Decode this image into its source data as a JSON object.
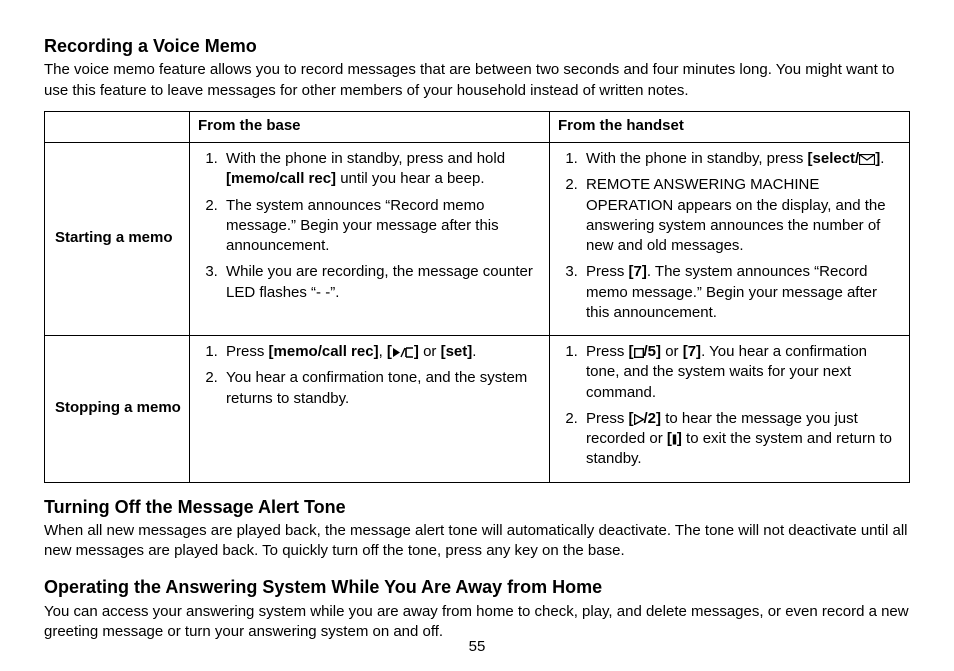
{
  "section1": {
    "title": "Recording a Voice Memo",
    "body": "The voice memo feature allows you to record messages that are between two seconds and four minutes long. You might want to use this feature to leave messages for other members of your household instead of written notes."
  },
  "table": {
    "col_base": "From the base",
    "col_handset": "From the handset",
    "row1_label": "Starting a memo",
    "row2_label": "Stopping a memo",
    "r1_base": {
      "s1a": "With the phone in standby, press and hold ",
      "s1b": "[memo/call rec]",
      "s1c": " until you hear a beep.",
      "s2": "The system announces “Record memo message.” Begin your message after this announcement.",
      "s3": "While you are recording, the message counter LED flashes “- -”."
    },
    "r1_hand": {
      "s1a": "With the phone in standby, press ",
      "s1b": "[select/",
      "s1c": "]",
      "s1d": ".",
      "s2": "REMOTE ANSWERING MACHINE OPERATION appears on the display, and the answering system announces the number of new and old messages.",
      "s3a": "Press ",
      "s3b": "[7]",
      "s3c": ". The system announces “Record memo message.” Begin your message after this announcement."
    },
    "r2_base": {
      "s1a": "Press ",
      "s1b": "[memo/call rec]",
      "s1c": ", ",
      "s1d": "[",
      "s1e": "]",
      "s1f": " or ",
      "s1g": "[set]",
      "s1h": ".",
      "s2": "You hear a confirmation tone, and the system returns to standby."
    },
    "r2_hand": {
      "s1a": "Press ",
      "s1b": "[",
      "s1c": "/5]",
      "s1d": " or ",
      "s1e": "[7]",
      "s1f": ". You hear a confirmation tone, and the system waits for your next command.",
      "s2a": "Press ",
      "s2b": "[",
      "s2c": "/2]",
      "s2d": " to hear the message you just recorded or ",
      "s2e": "[",
      "s2f": "]",
      "s2g": " to exit the system and return to standby."
    }
  },
  "section2": {
    "title": "Turning Off the Message Alert Tone",
    "body": "When all new messages are played back, the message alert tone will automatically deactivate. The tone will not deactivate until all new messages are played back. To quickly turn off the tone, press any key on the base."
  },
  "section3": {
    "title": "Operating the Answering System While You Are Away from Home",
    "body": "You can access your answering system while you are away from home to check, play, and delete messages, or even record a new greeting message or turn your answering system on and off."
  },
  "page_number": "55"
}
